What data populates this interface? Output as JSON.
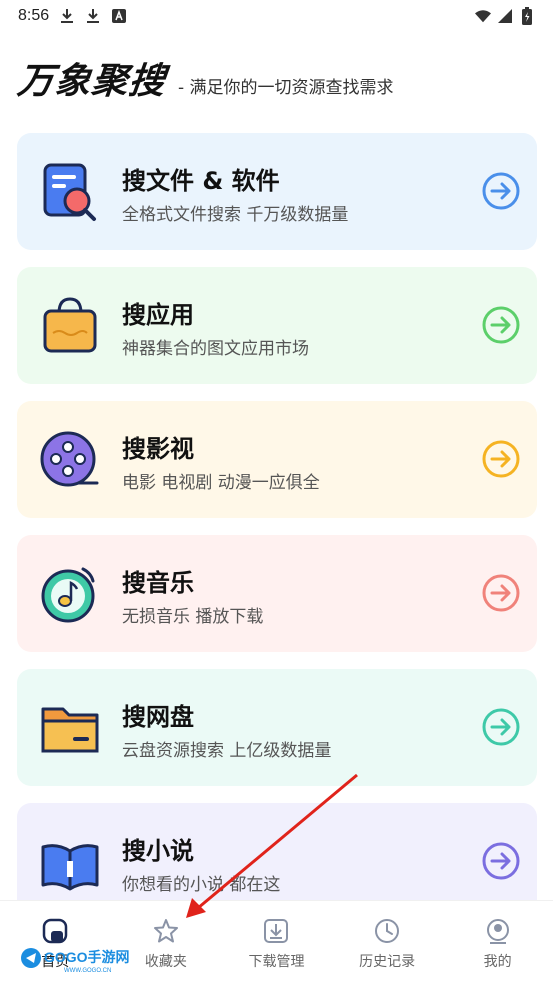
{
  "status_bar": {
    "time": "8:56",
    "icons": [
      "download-icon",
      "download-icon",
      "app-notification-icon",
      "wifi-icon",
      "signal-icon",
      "battery-icon"
    ]
  },
  "header": {
    "brand": "万象聚搜",
    "tagline": "- 满足你的一切资源查找需求"
  },
  "cards": [
    {
      "title": "搜文件 & 软件",
      "subtitle": "全格式文件搜索 千万级数据量",
      "icon": "file-search-icon",
      "bg": "#eaf4fd",
      "accent": "#4a8fea"
    },
    {
      "title": "搜应用",
      "subtitle": "神器集合的图文应用市场",
      "icon": "shopping-bag-icon",
      "bg": "#edfbef",
      "accent": "#5ccf6a"
    },
    {
      "title": "搜影视",
      "subtitle": "电影 电视剧 动漫一应俱全",
      "icon": "film-reel-icon",
      "bg": "#fff8e8",
      "accent": "#f5b323"
    },
    {
      "title": "搜音乐",
      "subtitle": "无损音乐 播放下载",
      "icon": "music-note-icon",
      "bg": "#fff1f0",
      "accent": "#f0827a"
    },
    {
      "title": "搜网盘",
      "subtitle": "云盘资源搜索 上亿级数据量",
      "icon": "folder-icon",
      "bg": "#ebfaf6",
      "accent": "#3ec9a8"
    },
    {
      "title": "搜小说",
      "subtitle": "你想看的小说 都在这",
      "icon": "book-icon",
      "bg": "#f1f0fd",
      "accent": "#7b6ee0"
    }
  ],
  "nav": [
    {
      "label": "首页",
      "icon": "home-icon",
      "active": true
    },
    {
      "label": "收藏夹",
      "icon": "star-icon",
      "active": false
    },
    {
      "label": "下载管理",
      "icon": "download-manage-icon",
      "active": false
    },
    {
      "label": "历史记录",
      "icon": "history-icon",
      "active": false
    },
    {
      "label": "我的",
      "icon": "profile-icon",
      "active": false
    }
  ],
  "watermark": {
    "text": "GOGO手游网",
    "url": "WWW.GOGO.CN"
  },
  "colors": {
    "annotation": "#e0231b"
  }
}
